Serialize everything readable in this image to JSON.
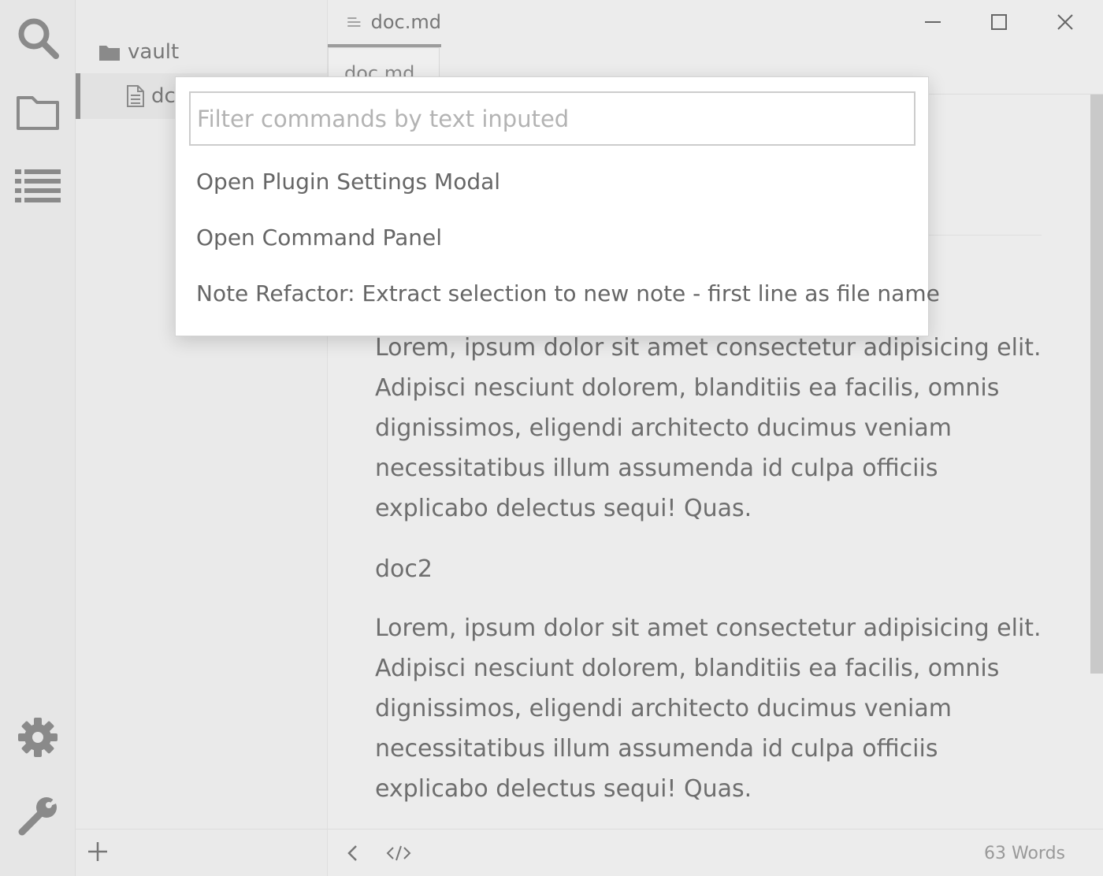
{
  "activity_bar": {
    "icons": [
      "search-icon",
      "folder-icon",
      "list-icon",
      "gear-icon",
      "wrench-icon"
    ]
  },
  "sidebar": {
    "folder_label": "vault",
    "file_label": "dc"
  },
  "titlebar": {
    "tab_title": "doc.md"
  },
  "tabstrip": {
    "tab_label": "doc.md"
  },
  "palette": {
    "placeholder": "Filter commands by text inputed",
    "commands": [
      "Open Plugin Settings Modal",
      "Open Command Panel",
      "Note Refactor: Extract selection to new note - first line as file name"
    ]
  },
  "editor": {
    "paragraph1": "Lorem, ipsum dolor sit amet consectetur adipisicing elit. Adipisci nesciunt dolorem, blanditiis ea facilis, omnis dignissimos, eligendi architecto ducimus veniam necessitatibus illum assumenda id culpa officiis explicabo delectus sequi! Quas.",
    "heading": "doc2",
    "paragraph2": "Lorem, ipsum dolor sit amet consectetur adipisicing elit. Adipisci nesciunt dolorem, blanditiis ea facilis, omnis dignissimos, eligendi architecto ducimus veniam necessitatibus illum assumenda id culpa officiis explicabo delectus sequi! Quas."
  },
  "statusbar": {
    "word_count": "63 Words"
  },
  "colors": {
    "background": "#ececec",
    "icon": "#8a8a8a",
    "palette_bg": "#ffffff"
  }
}
